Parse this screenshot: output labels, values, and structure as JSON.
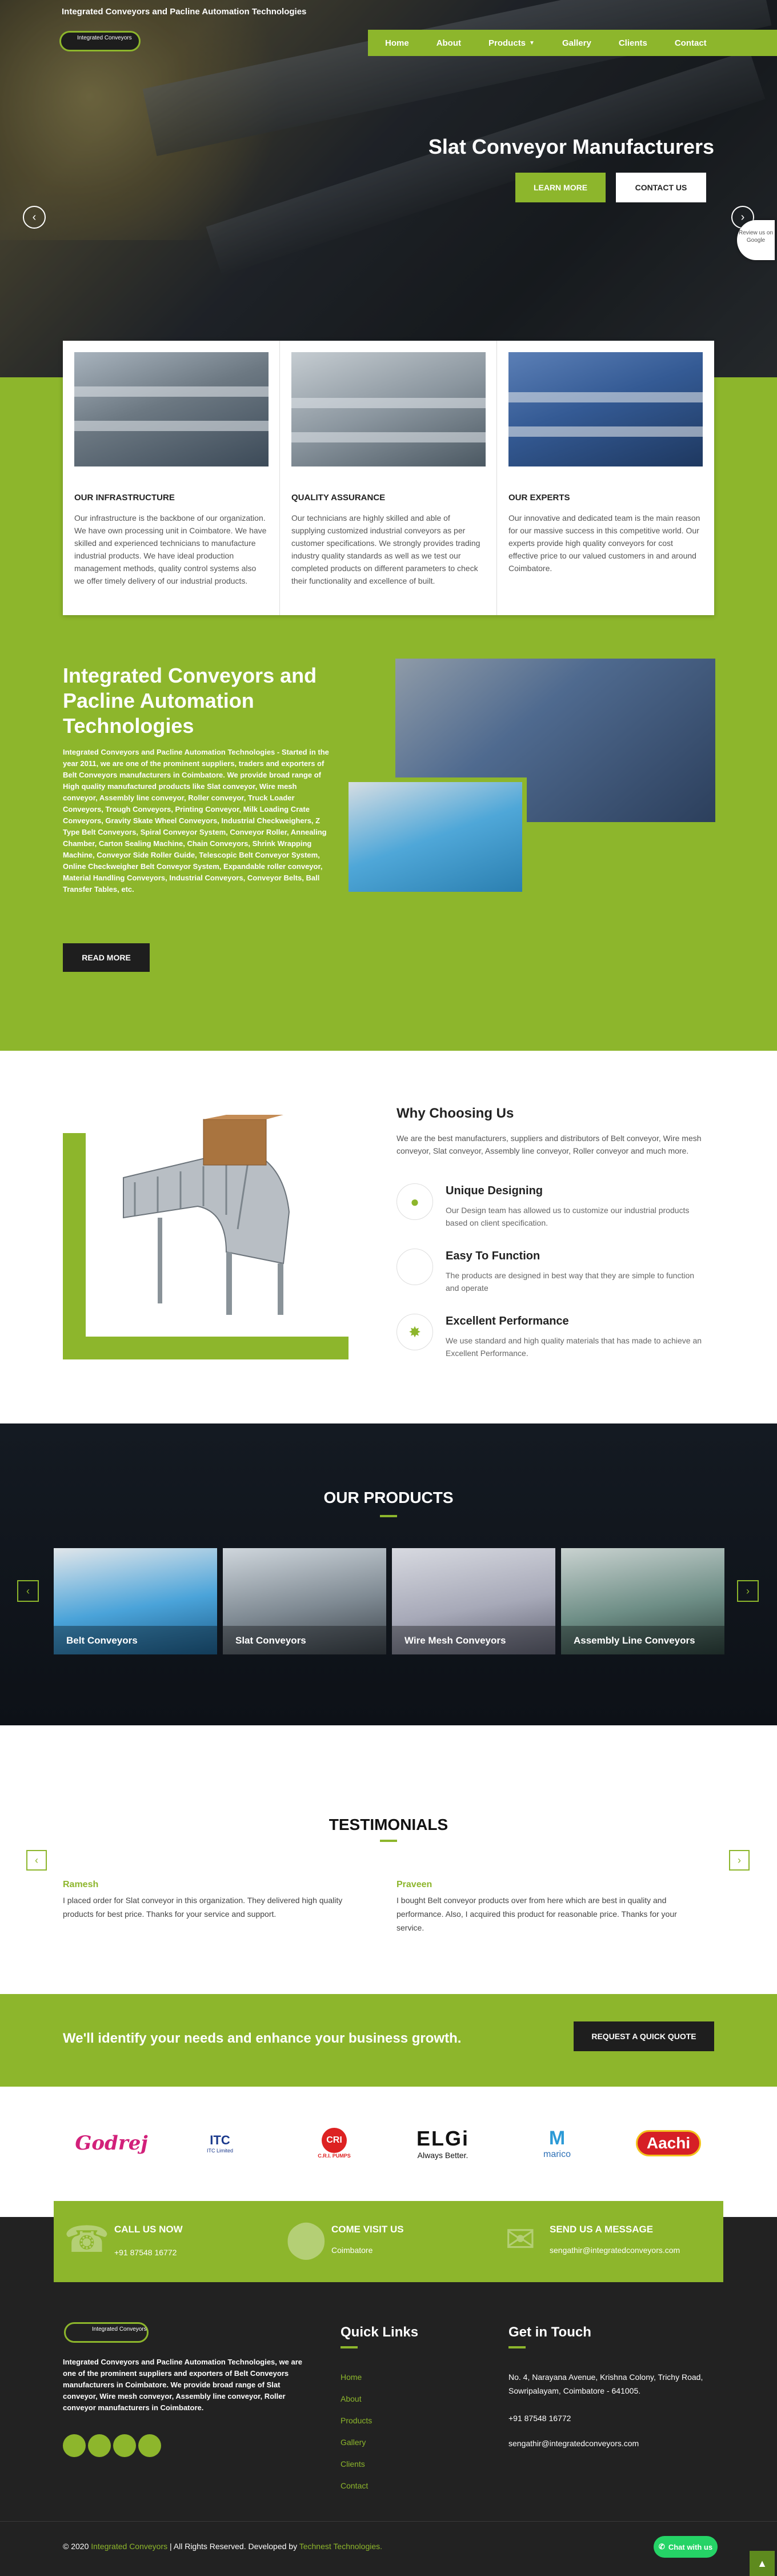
{
  "header": {
    "site_title": "Integrated Conveyors and Pacline Automation Technologies",
    "logo_text": "Integrated Conveyors",
    "nav": [
      "Home",
      "About",
      "Products",
      "Gallery",
      "Clients",
      "Contact"
    ]
  },
  "hero": {
    "title": "Slat Conveyor Manufacturers",
    "learn_more": "LEARN MORE",
    "contact_us": "CONTACT US",
    "prev_arrow": "‹",
    "next_arrow": "›",
    "badge": "Review us on Google"
  },
  "features": [
    {
      "title": "OUR INFRASTRUCTURE",
      "text": "Our infrastructure is the backbone of our organization. We have own processing unit in Coimbatore. We have skilled and experienced technicians to manufacture industrial products. We have ideal production management methods, quality control systems also we offer timely delivery of our industrial products."
    },
    {
      "title": "QUALITY ASSURANCE",
      "text": "Our technicians are highly skilled and able of supplying customized industrial conveyors as per customer specifications. We strongly provides trading industry quality standards as well as we test our completed products on different parameters to check their functionality and excellence of built."
    },
    {
      "title": "OUR EXPERTS",
      "text": "Our innovative and dedicated team is the main reason for our massive success in this competitive world. Our experts provide high quality conveyors for cost effective price to our valued customers in and around Coimbatore."
    }
  ],
  "about": {
    "title": "Integrated Conveyors and Pacline Automation Technologies",
    "text": "Integrated Conveyors and Pacline Automation Technologies - Started in the year 2011, we are one of the prominent suppliers, traders and exporters of Belt Conveyors manufacturers in Coimbatore. We provide broad range of High quality manufactured products like Slat conveyor, Wire mesh conveyor, Assembly line conveyor, Roller conveyor, Truck Loader Conveyors, Trough Conveyors, Printing Conveyor, Milk Loading Crate Conveyors, Gravity Skate Wheel Conveyors, Industrial Checkweighers, Z Type Belt Conveyors, Spiral Conveyor System, Conveyor Roller, Annealing Chamber, Carton Sealing Machine, Chain Conveyors, Shrink Wrapping Machine, Conveyor Side Roller Guide, Telescopic Belt Conveyor System, Online Checkweigher Belt Conveyor System, Expandable roller conveyor, Material Handling Conveyors, Industrial Conveyors, Conveyor Belts, Ball Transfer Tables, etc.",
    "button": "READ MORE"
  },
  "why": {
    "title": "Why Choosing Us",
    "text": "We are the best manufacturers, suppliers and distributors of Belt conveyor, Wire mesh conveyor, Slat conveyor, Assembly line conveyor, Roller conveyor and much more.",
    "items": [
      {
        "title": "Unique Designing",
        "text": "Our Design team has allowed us to customize our industrial products based on client specification.",
        "icon": "bulb-icon"
      },
      {
        "title": "Easy To Function",
        "text": "The products are designed in best way that they are simple to function and operate",
        "icon": "circle-icon"
      },
      {
        "title": "Excellent Performance",
        "text": "We use standard and high quality materials that has made to achieve an Excellent Performance.",
        "icon": "badge-icon"
      }
    ]
  },
  "products": {
    "title": "OUR PRODUCTS",
    "items": [
      "Belt Conveyors",
      "Slat Conveyors",
      "Wire Mesh Conveyors",
      "Assembly Line Conveyors"
    ]
  },
  "testimonials": {
    "title": "TESTIMONIALS",
    "items": [
      {
        "name": "Ramesh",
        "text": "I placed order for Slat conveyor in this organization. They delivered high quality products for best price. Thanks for your service and support."
      },
      {
        "name": "Praveen",
        "text": "I bought Belt conveyor products over from here which are best in quality and performance. Also, I acquired this product for reasonable price. Thanks for your service."
      }
    ]
  },
  "cta": {
    "text": "We'll identify your needs and enhance your business growth.",
    "button": "REQUEST A QUICK QUOTE"
  },
  "clients": {
    "godrej": "Godrej",
    "itc": "ITC",
    "itc_sub": "ITC Limited",
    "cri": "CRI",
    "cri_sub": "C.R.I. PUMPS",
    "elgi": "ELGi",
    "elgi_sub": "Always Better.",
    "marico": "marico",
    "aachi": "Aachi"
  },
  "contact_strip": [
    {
      "title": "CALL US NOW",
      "value": "+91  87548  16772"
    },
    {
      "title": "COME VISIT US",
      "value": "Coimbatore"
    },
    {
      "title": "SEND US A MESSAGE",
      "value": "sengathir@integratedconveyors.com"
    }
  ],
  "footer": {
    "logo_text": "Integrated Conveyors",
    "about": "Integrated Conveyors and Pacline Automation Technologies, we are one of the prominent suppliers and exporters of Belt Conveyors manufacturers in Coimbatore. We provide broad range of Slat conveyor, Wire mesh conveyor, Assembly line conveyor, Roller conveyor manufacturers in Coimbatore.",
    "quick_links_title": "Quick Links",
    "quick_links": [
      "Home",
      "About",
      "Products",
      "Gallery",
      "Clients",
      "Contact"
    ],
    "touch_title": "Get in Touch",
    "address": "No. 4, Narayana Avenue, Krishna Colony, Trichy Road, Sowripalayam, Coimbatore - 641005.",
    "phone": "+91  87548  16772",
    "email": "sengathir@integratedconveyors.com",
    "copy_prefix": "© 2020",
    "copy_brand": "Integrated Conveyors",
    "copy_mid": "| All Rights Reserved. Developed by",
    "copy_dev": "Technest Technologies.",
    "chat": "Chat with us"
  },
  "colors": {
    "accent": "#8db62c",
    "dark": "#1e1e1e"
  }
}
